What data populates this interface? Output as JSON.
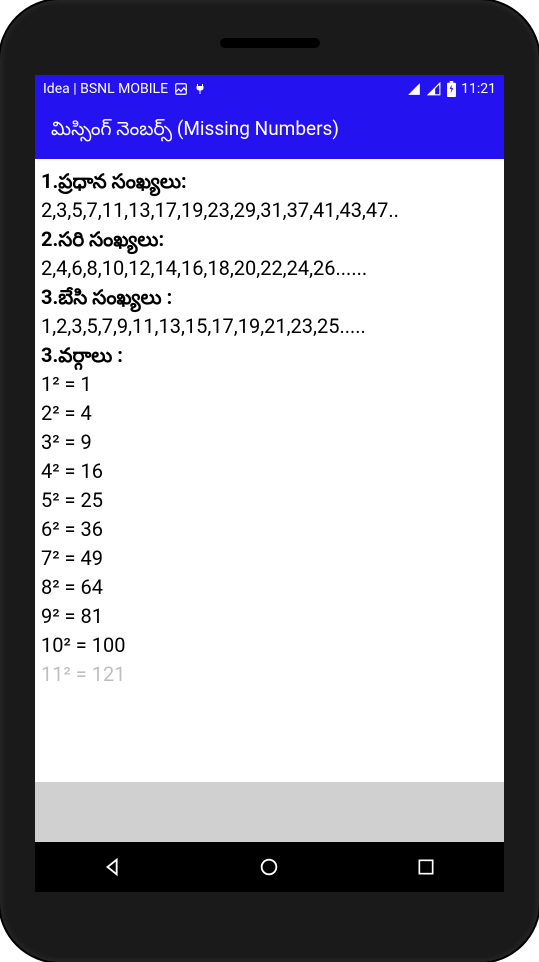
{
  "status": {
    "carrier": "Idea | BSNL MOBILE",
    "time": "11:21"
  },
  "appbar": {
    "title": "మిస్సింగ్ నెంబర్స్ (Missing Numbers)"
  },
  "content": {
    "h1": "1.ప్రధాన సంఖ్యలు:",
    "seq1": "2,3,5,7,11,13,17,19,23,29,31,37,41,43,47..",
    "h2": "2.సరి సంఖ్యలు:",
    "seq2": "2,4,6,8,10,12,14,16,18,20,22,24,26......",
    "h3": "3.బేసి సంఖ్యలు :",
    "seq3": "1,2,3,5,7,9,11,13,15,17,19,21,23,25.....",
    "h4": "3.వర్గాలు :",
    "sq1": "1² = 1",
    "sq2": "2² = 4",
    "sq3": "3² = 9",
    "sq4": "4² = 16",
    "sq5": "5² = 25",
    "sq6": "6² = 36",
    "sq7": "7² = 49",
    "sq8": "8² = 64",
    "sq9": "9² = 81",
    "sq10": "10² = 100",
    "sq11": "11² = 121"
  }
}
